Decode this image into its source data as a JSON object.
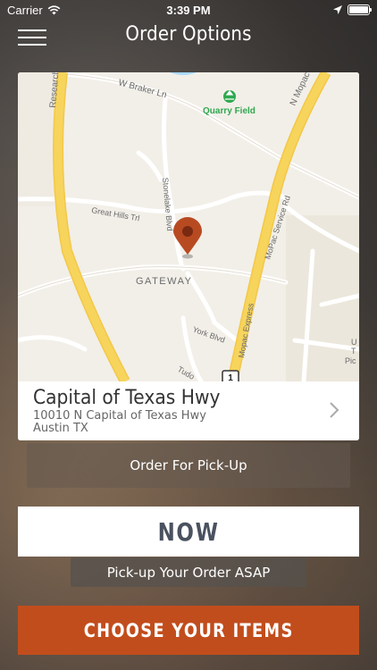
{
  "status_bar": {
    "carrier": "Carrier",
    "time": "3:39 PM",
    "icons": [
      "wifi-icon",
      "location-arrow-icon",
      "battery-icon"
    ]
  },
  "header": {
    "title": "Order Options",
    "menu_icon": "hamburger-menu-icon"
  },
  "map": {
    "labels": {
      "research": "Research",
      "braker": "W Braker Ln",
      "quarry": "Quarry Field",
      "mopac_n": "N Mopac",
      "stonelake": "Stonelake Blvd",
      "great_hills": "Great Hills Trl",
      "mopac_service": "MoPac Service Rd",
      "gateway": "GATEWAY",
      "mopac_express": "Mopac Express",
      "york": "York Blvd",
      "tudor": "Tudo",
      "shield": "1",
      "edge1": "U",
      "edge2": "T",
      "edge3": "Pic"
    },
    "pin_icon": "map-pin-icon"
  },
  "location": {
    "name": "Capital of  Texas Hwy",
    "street": "10010 N Capital of Texas Hwy",
    "city": "Austin TX"
  },
  "buttons": {
    "pickup": "Order For Pick-Up",
    "now": "NOW",
    "asap": "Pick-up Your Order ASAP",
    "choose": "CHOOSE YOUR ITEMS"
  },
  "colors": {
    "accent": "#c24d1c",
    "pin": "#b84a22",
    "highway": "#f7d45c",
    "park_icon": "#2fa84f"
  }
}
